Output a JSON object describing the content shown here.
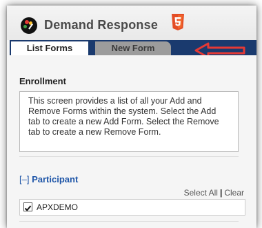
{
  "app": {
    "title": "Demand Response",
    "logo_icon": "speedometer-icon",
    "badge_icon": "html5-icon",
    "badge_color": "#e44d26"
  },
  "tabs": [
    {
      "label": "List Forms",
      "active": true
    },
    {
      "label": "New Form",
      "active": false
    }
  ],
  "annotation": {
    "icon": "red-arrow-icon",
    "color": "#e53935"
  },
  "enrollment": {
    "title": "Enrollment",
    "lines": [
      "This screen provides a list of all your Add and",
      "Remove Forms within the system. Select the Add",
      "tab to create a new Add Form. Select the Remove",
      "tab to create a new Remove Form."
    ]
  },
  "participant": {
    "toggle": "[–]",
    "label": "Participant",
    "select_all": "Select All",
    "separator": "|",
    "clear": "Clear",
    "items": [
      {
        "label": "APXDEMO",
        "checked": true
      }
    ]
  },
  "colors": {
    "tab_bar": "#1a3a6e",
    "link": "#1f56a8"
  }
}
